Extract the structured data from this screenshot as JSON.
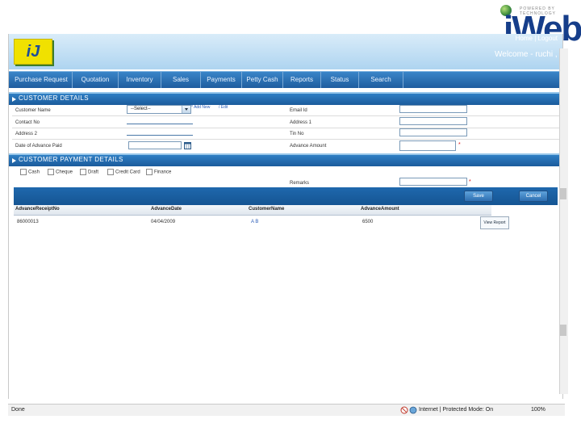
{
  "brand": {
    "corner_text": "iWeb",
    "corner_tag": "POWERED BY TECHNOLOGY"
  },
  "header": {
    "logo_text": "iJ",
    "home_link": "Home",
    "logout_link": "Logout",
    "welcome": "Welcome - ruchi , Pune"
  },
  "nav": {
    "items": [
      "Purchase Request",
      "Quotation",
      "Inventory",
      "Sales",
      "Payments",
      "Petty Cash",
      "Reports",
      "Status",
      "Search"
    ]
  },
  "customer_details": {
    "title": "CUSTOMER DETAILS",
    "customer_name_label": "Customer Name",
    "customer_name_value": "--Select--",
    "add_new_link": "Add New",
    "edit_link": "Edit",
    "contact_label": "Contact No",
    "address2_label": "Address 2",
    "date_label": "Date of Advance Paid",
    "email_label": "Email Id",
    "address1_label": "Address 1",
    "tin_label": "Tin No",
    "advance_label": "Advance Amount"
  },
  "payment_details": {
    "title": "CUSTOMER PAYMENT DETAILS",
    "options": [
      "Cash",
      "Cheque",
      "Draft",
      "Credit Card",
      "Finance"
    ],
    "remarks_label": "Remarks"
  },
  "buttons": {
    "save": "Save",
    "cancel": "Cancel"
  },
  "grid": {
    "headers": [
      "AdvanceReceiptNo",
      "AdvanceDate",
      "CustomerName",
      "AdvanceAmount"
    ],
    "rows": [
      {
        "receipt": "86000013",
        "date": "04/04/2009",
        "customer": "A B",
        "amount": "6500",
        "action": "View Report"
      }
    ]
  },
  "statusbar": {
    "left": "Done",
    "zone": "Internet | Protected Mode: On",
    "zoom": "100%"
  }
}
